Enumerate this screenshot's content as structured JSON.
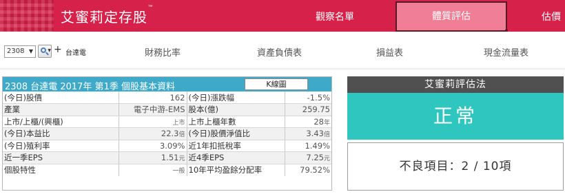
{
  "header": {
    "brand": "艾蜜莉定存股",
    "brand_tm": "™",
    "nav": {
      "watchlist": "觀察名單",
      "health": "體質評估",
      "valuation": "估價"
    }
  },
  "toolbar": {
    "stock_code": "2308",
    "stock_name": "台達電",
    "add_label": "+",
    "tabs": [
      "財務比率",
      "資產負債表",
      "損益表",
      "現金流量表"
    ]
  },
  "basic_info": {
    "title": "2308 台達電 2017年 第1季 個股基本資料",
    "kline_label": "K線圖",
    "rows": [
      {
        "label1": "(今日)股價",
        "value1": "162",
        "unit1": "",
        "label2": "(今日)漲跌幅",
        "value2": "-1.5%",
        "unit2": ""
      },
      {
        "label1": "產業",
        "value1": "電子中游-EMS",
        "unit1": "",
        "label2": "股本(億)",
        "value2": "259.75",
        "unit2": ""
      },
      {
        "label1": "上市/上櫃/(興櫃)",
        "value1": "",
        "unit1": "上市",
        "label2": "上市上櫃年數",
        "value2": "28",
        "unit2": "年"
      },
      {
        "label1": "(今日)本益比",
        "value1": "22.3",
        "unit1": "倍",
        "label2": "(今日)股價淨值比",
        "value2": "3.43",
        "unit2": "倍"
      },
      {
        "label1": "(今日)殖利率",
        "value1": "3.09%",
        "unit1": "",
        "label2": "近1年扣抵稅率",
        "value2": "1.49%",
        "unit2": ""
      },
      {
        "label1": "近一季EPS",
        "value1": "1.51",
        "unit1": "元",
        "label2": "近4季EPS",
        "value2": "7.25",
        "unit2": "元"
      },
      {
        "label1": "個股特性",
        "value1": "",
        "unit1": "一般",
        "label2": "10年平均盈餘分配率",
        "value2": "79.52%",
        "unit2": ""
      }
    ]
  },
  "assessment": {
    "title": "艾蜜莉評估法",
    "status": "正常",
    "bad_items": "不良項目：2 / 10項"
  },
  "colors": {
    "brand_red": "#d6224a",
    "active_tab_pink": "#f07e96",
    "info_header_blue": "#3ea9c9",
    "status_teal": "#2fc6c0",
    "dark_header": "#505050"
  }
}
